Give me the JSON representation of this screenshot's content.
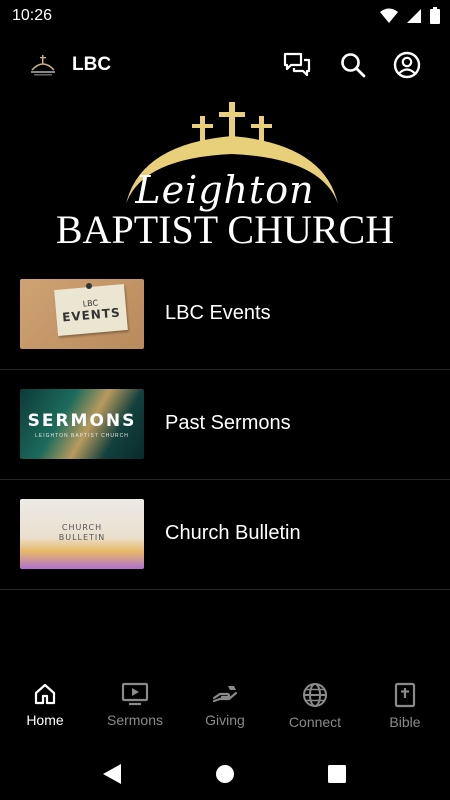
{
  "status_bar": {
    "time": "10:26"
  },
  "app_bar": {
    "title": "LBC"
  },
  "banner": {
    "line1": "Leighton",
    "line2": "BAPTIST CHURCH"
  },
  "items": [
    {
      "label": "LBC Events",
      "thumb_small": "LBC",
      "thumb_big": "EVENTS"
    },
    {
      "label": "Past Sermons",
      "thumb_big": "SERMONS",
      "thumb_small": "LEIGHTON BAPTIST CHURCH"
    },
    {
      "label": "Church Bulletin",
      "thumb_big": "CHURCH\nBULLETIN"
    }
  ],
  "nav": [
    {
      "label": "Home",
      "icon": "home-icon",
      "active": true
    },
    {
      "label": "Sermons",
      "icon": "video-icon",
      "active": false
    },
    {
      "label": "Giving",
      "icon": "giving-icon",
      "active": false
    },
    {
      "label": "Connect",
      "icon": "globe-icon",
      "active": false
    },
    {
      "label": "Bible",
      "icon": "bible-icon",
      "active": false
    }
  ],
  "colors": {
    "background": "#000000",
    "gold": "#e8cf7a",
    "inactive": "#8a8a8a"
  }
}
